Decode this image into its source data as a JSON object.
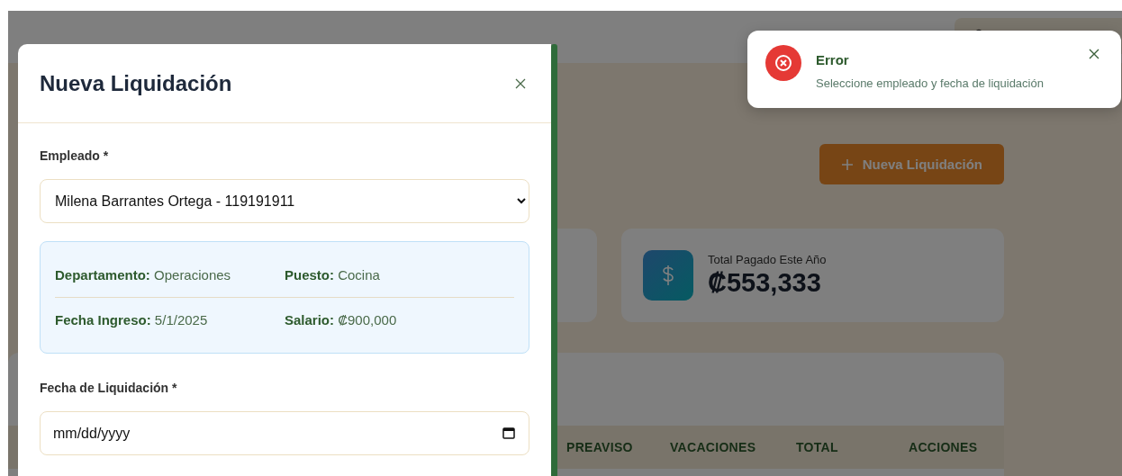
{
  "page": {
    "new_button": "Nueva Liquidación",
    "stat_cards": [
      {
        "label": "Total Pagado Este Año",
        "value": "₡553,333"
      }
    ],
    "table": {
      "columns": [
        "PREAVISO",
        "VACACIONES",
        "TOTAL",
        "ACCIONES"
      ]
    }
  },
  "modal": {
    "title": "Nueva Liquidación",
    "fields": [
      {
        "kind": "select",
        "label": "Empleado *",
        "value": "Milena Barrantes Ortega - 119191911"
      },
      {
        "kind": "info",
        "rows": [
          [
            {
              "label": "Departamento:",
              "value": "Operaciones"
            },
            {
              "label": "Puesto:",
              "value": "Cocina"
            }
          ],
          [
            {
              "label": "Fecha Ingreso:",
              "value": "5/1/2025"
            },
            {
              "label": "Salario:",
              "value": "₡900,000"
            }
          ]
        ]
      },
      {
        "kind": "date",
        "label": "Fecha de Liquidación *",
        "placeholder": "mm/dd/yyyy"
      }
    ]
  },
  "toast": {
    "kind": "error",
    "title": "Error",
    "message": "Seleccione empleado y fecha de liquidación"
  }
}
